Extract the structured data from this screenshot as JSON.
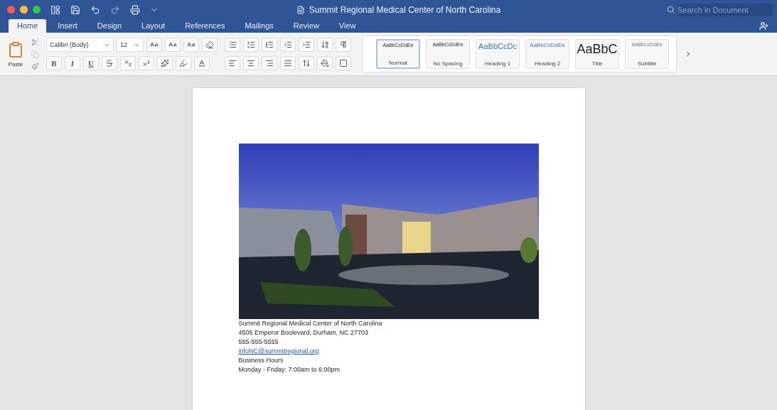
{
  "window": {
    "title": "Summit Regional Medical Center of North Carolina"
  },
  "search": {
    "placeholder": "Search in Document"
  },
  "tabs": [
    {
      "label": "Home",
      "selected": true
    },
    {
      "label": "Insert",
      "selected": false
    },
    {
      "label": "Design",
      "selected": false
    },
    {
      "label": "Layout",
      "selected": false
    },
    {
      "label": "References",
      "selected": false
    },
    {
      "label": "Mailings",
      "selected": false
    },
    {
      "label": "Review",
      "selected": false
    },
    {
      "label": "View",
      "selected": false
    }
  ],
  "ribbon": {
    "paste_label": "Paste",
    "font": "Calibri (Body)",
    "font_size": "12",
    "format_buttons": [
      "B",
      "I",
      "U"
    ],
    "styles": [
      {
        "sample": "AaBbCcDdEe",
        "name": "Normal",
        "kind": "normal",
        "selected": true
      },
      {
        "sample": "AaBbCcDdEe",
        "name": "No Spacing",
        "kind": "normal",
        "selected": false
      },
      {
        "sample": "AaBbCcDc",
        "name": "Heading 1",
        "kind": "heading1",
        "selected": false
      },
      {
        "sample": "AaBbCcDdEe",
        "name": "Heading 2",
        "kind": "heading2",
        "selected": false
      },
      {
        "sample": "AaBbC",
        "name": "Title",
        "kind": "title",
        "selected": false
      },
      {
        "sample": "AaBbCcDdEe",
        "name": "Subtitle",
        "kind": "subtitle",
        "selected": false
      }
    ]
  },
  "document": {
    "lines": [
      {
        "kind": "text",
        "text": "Summit Regional Medical Center of North Carolina"
      },
      {
        "kind": "text",
        "text": "4505 Emperor Boulevard, Durham, NC 27703"
      },
      {
        "kind": "text",
        "text": "555-555-5555"
      },
      {
        "kind": "link",
        "text": "infoNC@summitregional.org"
      },
      {
        "kind": "text",
        "text": "Business Hours"
      },
      {
        "kind": "text",
        "text": "Monday - Friday: 7:00am to 6:00pm"
      }
    ]
  }
}
